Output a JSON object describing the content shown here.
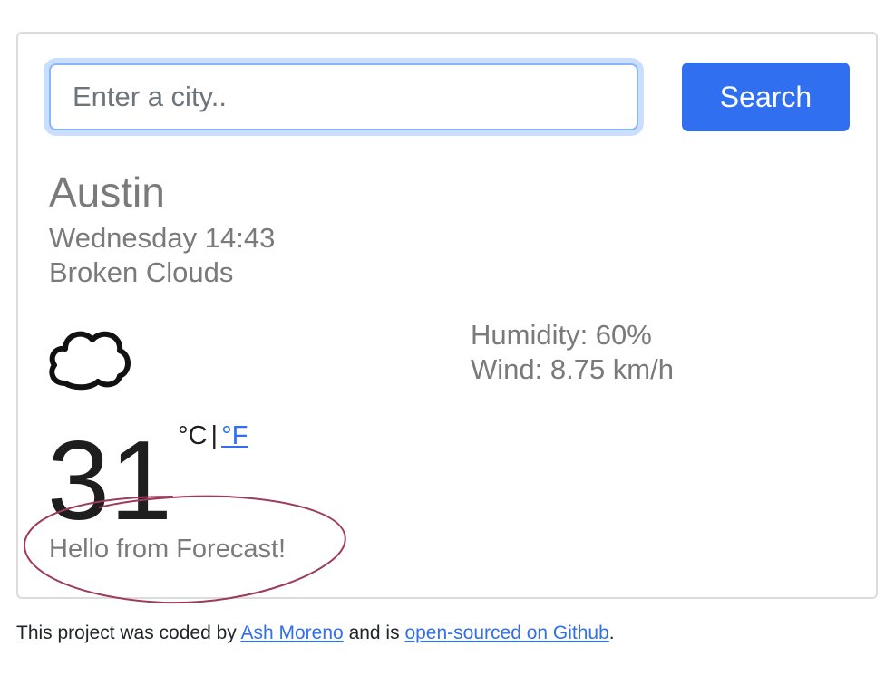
{
  "search": {
    "placeholder": "Enter a city..",
    "value": "",
    "button_label": "Search"
  },
  "weather": {
    "city": "Austin",
    "datetime": "Wednesday 14:43",
    "description": "Broken Clouds",
    "icon": "cloud-icon",
    "temperature": "31",
    "unit_celsius": "°C",
    "unit_separator": "|",
    "unit_fahrenheit": "°F",
    "humidity": "Humidity: 60%",
    "wind": "Wind: 8.75 km/h",
    "message": "Hello from Forecast!"
  },
  "footer": {
    "text_before": "This project was coded by",
    "author_link": "Ash Moreno",
    "text_middle": "and is",
    "repo_link": "open-sourced on Github",
    "text_after": "."
  },
  "colors": {
    "accent": "#2f6ff0",
    "muted_text": "#7a7a7a",
    "annotation": "#9c3b5a"
  }
}
